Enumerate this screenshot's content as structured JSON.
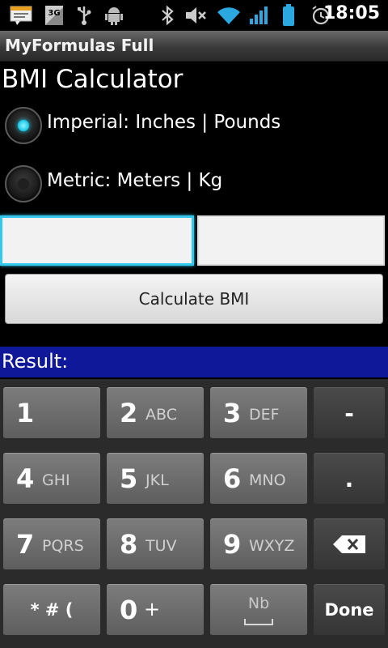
{
  "status_bar": {
    "time": "18:05",
    "network_label": "3G",
    "icons": [
      "notification-icon",
      "3g-icon",
      "usb-icon",
      "android-debug-icon",
      "bluetooth-icon",
      "mute-icon",
      "wifi-icon",
      "signal-icon",
      "battery-icon",
      "alarm-icon"
    ]
  },
  "app": {
    "title": "MyFormulas Full"
  },
  "calculator": {
    "heading": "BMI Calculator",
    "options": [
      {
        "label": "Imperial: Inches | Pounds",
        "checked": true
      },
      {
        "label": "Metric: Meters | Kg",
        "checked": false
      }
    ],
    "height_value": "",
    "weight_value": "",
    "calculate_label": "Calculate BMI",
    "result_label": "Result:"
  },
  "keypad": {
    "row1": [
      {
        "num": "1",
        "sub": ""
      },
      {
        "num": "2",
        "sub": "ABC"
      },
      {
        "num": "3",
        "sub": "DEF"
      },
      {
        "sym": "-"
      }
    ],
    "row2": [
      {
        "num": "4",
        "sub": "GHI"
      },
      {
        "num": "5",
        "sub": "JKL"
      },
      {
        "num": "6",
        "sub": "MNO"
      },
      {
        "sym": "."
      }
    ],
    "row3": [
      {
        "num": "7",
        "sub": "PQRS"
      },
      {
        "num": "8",
        "sub": "TUV"
      },
      {
        "num": "9",
        "sub": "WXYZ"
      }
    ],
    "row4": [
      {
        "sym": "* # ("
      },
      {
        "num": "0",
        "sub": "+"
      },
      {
        "sym": "Nb"
      },
      {
        "sym": "Done"
      }
    ]
  },
  "colors": {
    "accent": "#35c8ee",
    "result_bar": "#10189a"
  }
}
